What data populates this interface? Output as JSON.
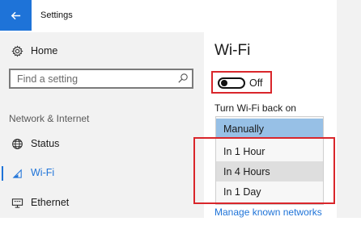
{
  "window": {
    "title": "Settings"
  },
  "sidebar": {
    "home_label": "Home",
    "search": {
      "placeholder": "Find a setting"
    },
    "section_label": "Network & Internet",
    "items": [
      {
        "label": "Status",
        "icon": "globe-icon"
      },
      {
        "label": "Wi-Fi",
        "icon": "wifi-icon",
        "active": true
      },
      {
        "label": "Ethernet",
        "icon": "ethernet-icon"
      }
    ]
  },
  "main": {
    "title": "Wi-Fi",
    "wifi_toggle": {
      "state": "Off",
      "on": false
    },
    "turn_back_label": "Turn Wi-Fi back on",
    "dropdown_options": [
      {
        "label": "Manually",
        "selected": true
      },
      {
        "label": "In 1 Hour"
      },
      {
        "label": "In 4 Hours",
        "hovered": true
      },
      {
        "label": "In 1 Day"
      }
    ],
    "manage_link": "Manage known networks"
  },
  "colors": {
    "accent": "#1e73d8",
    "highlight_border": "#d9262b",
    "selected_option": "#97c0e6",
    "sidebar_bg": "#f2f2f2"
  }
}
